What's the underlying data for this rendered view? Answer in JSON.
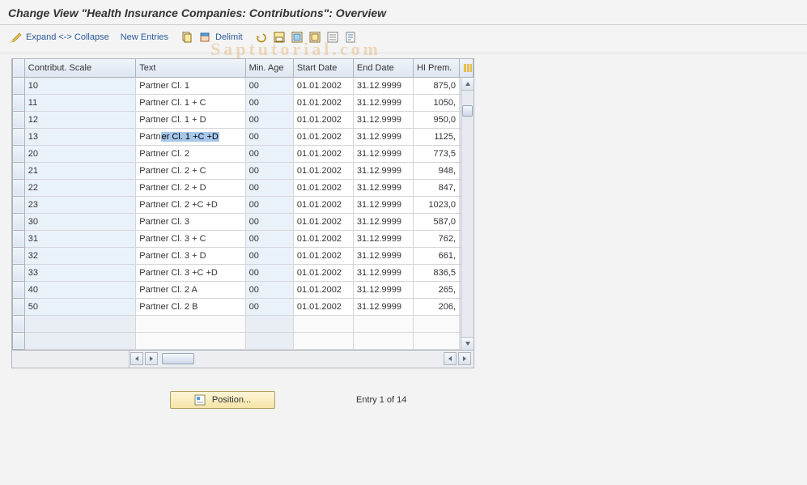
{
  "title": "Change View \"Health Insurance Companies: Contributions\": Overview",
  "toolbar": {
    "expand_collapse": "Expand <-> Collapse",
    "new_entries": "New Entries",
    "delimit": "Delimit"
  },
  "columns": {
    "scale": "Contribut. Scale",
    "text": "Text",
    "min_age": "Min. Age",
    "start": "Start Date",
    "end": "End Date",
    "prem": "HI Prem."
  },
  "rows": [
    {
      "scale": "10",
      "text": "Partner Cl. 1",
      "min": "00",
      "start": "01.01.2002",
      "end": "31.12.9999",
      "prem": "875,0"
    },
    {
      "scale": "11",
      "text": "Partner Cl. 1 + C",
      "min": "00",
      "start": "01.01.2002",
      "end": "31.12.9999",
      "prem": "1050,"
    },
    {
      "scale": "12",
      "text": "Partner Cl. 1 + D",
      "min": "00",
      "start": "01.01.2002",
      "end": "31.12.9999",
      "prem": "950,0"
    },
    {
      "scale": "13",
      "text_pre": "Partn",
      "text_sel": "er Cl. 1 +C +D",
      "min": "00",
      "start": "01.01.2002",
      "end": "31.12.9999",
      "prem": "1125,"
    },
    {
      "scale": "20",
      "text": "Partner Cl. 2",
      "min": "00",
      "start": "01.01.2002",
      "end": "31.12.9999",
      "prem": "773,5"
    },
    {
      "scale": "21",
      "text": "Partner Cl. 2 + C",
      "min": "00",
      "start": "01.01.2002",
      "end": "31.12.9999",
      "prem": "948,"
    },
    {
      "scale": "22",
      "text": "Partner Cl. 2 + D",
      "min": "00",
      "start": "01.01.2002",
      "end": "31.12.9999",
      "prem": "847,"
    },
    {
      "scale": "23",
      "text": "Partner Cl. 2 +C +D",
      "min": "00",
      "start": "01.01.2002",
      "end": "31.12.9999",
      "prem": "1023,0"
    },
    {
      "scale": "30",
      "text": "Partner Cl. 3",
      "min": "00",
      "start": "01.01.2002",
      "end": "31.12.9999",
      "prem": "587,0"
    },
    {
      "scale": "31",
      "text": "Partner Cl. 3 + C",
      "min": "00",
      "start": "01.01.2002",
      "end": "31.12.9999",
      "prem": "762,"
    },
    {
      "scale": "32",
      "text": "Partner Cl. 3 + D",
      "min": "00",
      "start": "01.01.2002",
      "end": "31.12.9999",
      "prem": "661,"
    },
    {
      "scale": "33",
      "text": "Partner Cl. 3 +C +D",
      "min": "00",
      "start": "01.01.2002",
      "end": "31.12.9999",
      "prem": "836,5"
    },
    {
      "scale": "40",
      "text": "Partner Cl. 2 A",
      "min": "00",
      "start": "01.01.2002",
      "end": "31.12.9999",
      "prem": "265,"
    },
    {
      "scale": "50",
      "text": "Partner Cl. 2 B",
      "min": "00",
      "start": "01.01.2002",
      "end": "31.12.9999",
      "prem": "206,"
    }
  ],
  "position_button": "Position...",
  "entry_status": "Entry 1 of 14"
}
